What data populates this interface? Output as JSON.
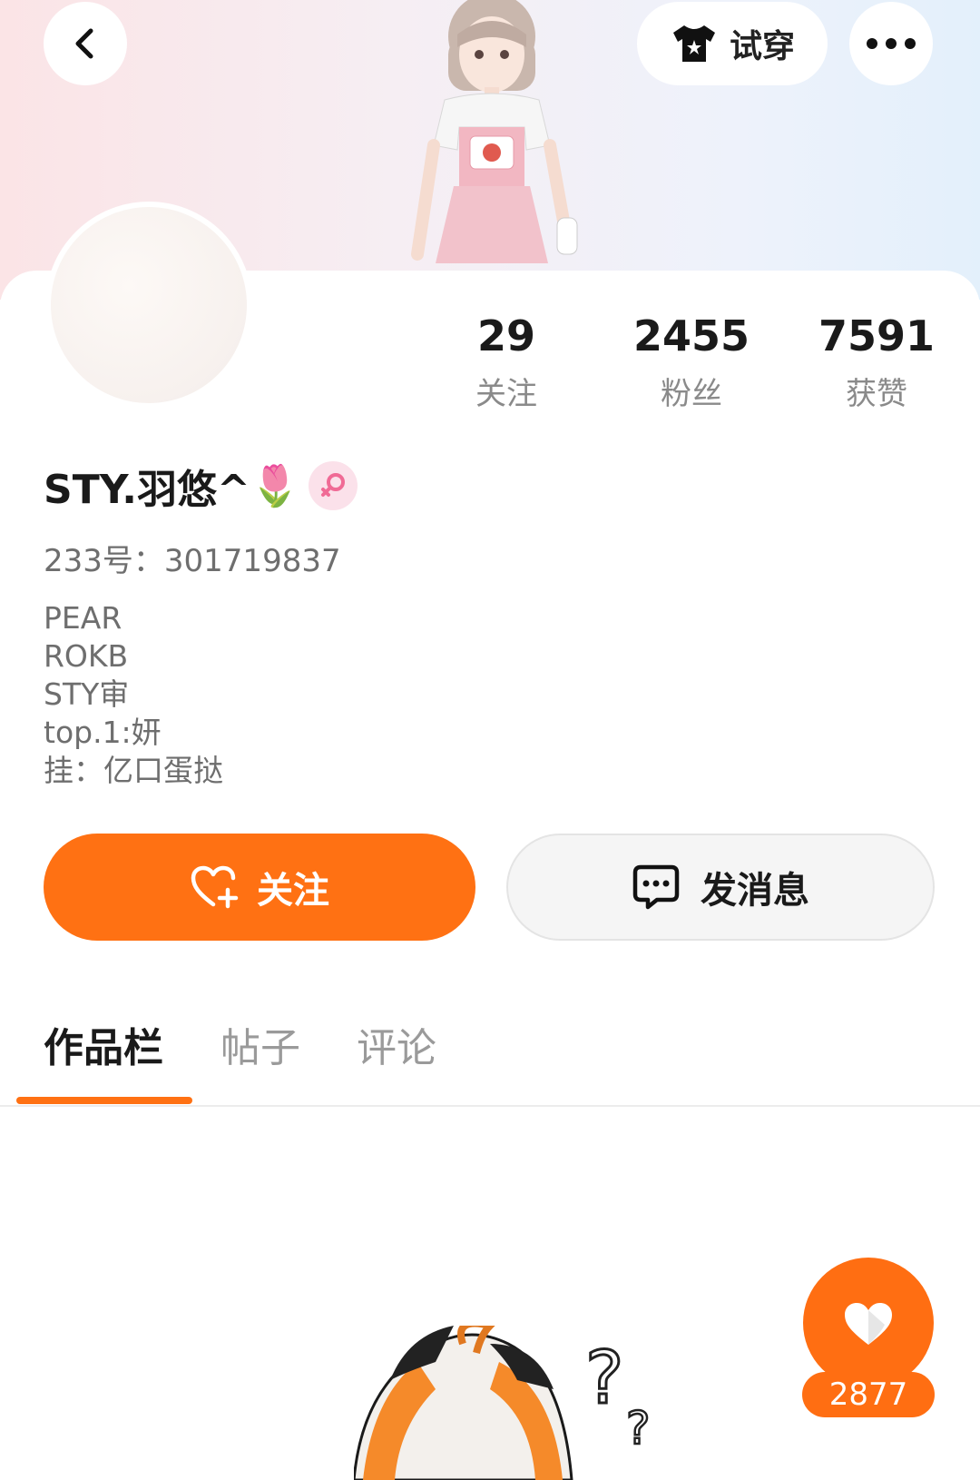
{
  "header": {
    "try_on_label": "试穿",
    "back_icon": "chevron-left-icon",
    "more_icon": "more-horizontal-icon",
    "shirt_icon": "tshirt-icon"
  },
  "stats": [
    {
      "value": "29",
      "label": "关注"
    },
    {
      "value": "2455",
      "label": "粉丝"
    },
    {
      "value": "7591",
      "label": "获赞"
    }
  ],
  "profile": {
    "name": "STY.羽悠^",
    "name_emoji": "🌷",
    "gender_icon": "female-icon",
    "id_label": "233号：",
    "id_value": "301719837",
    "bio_lines": [
      "PEAR",
      "ROKB",
      "STY审",
      "top.1:妍",
      "挂：亿口蛋挞"
    ]
  },
  "actions": {
    "follow_label": "关注",
    "message_label": "发消息"
  },
  "tabs": [
    {
      "label": "作品栏",
      "active": true
    },
    {
      "label": "帖子",
      "active": false
    },
    {
      "label": "评论",
      "active": false
    }
  ],
  "like_fab": {
    "count": "2877"
  },
  "colors": {
    "accent": "#ff7113",
    "text_primary": "#1a1a1a",
    "text_secondary": "#6e6e6e"
  }
}
